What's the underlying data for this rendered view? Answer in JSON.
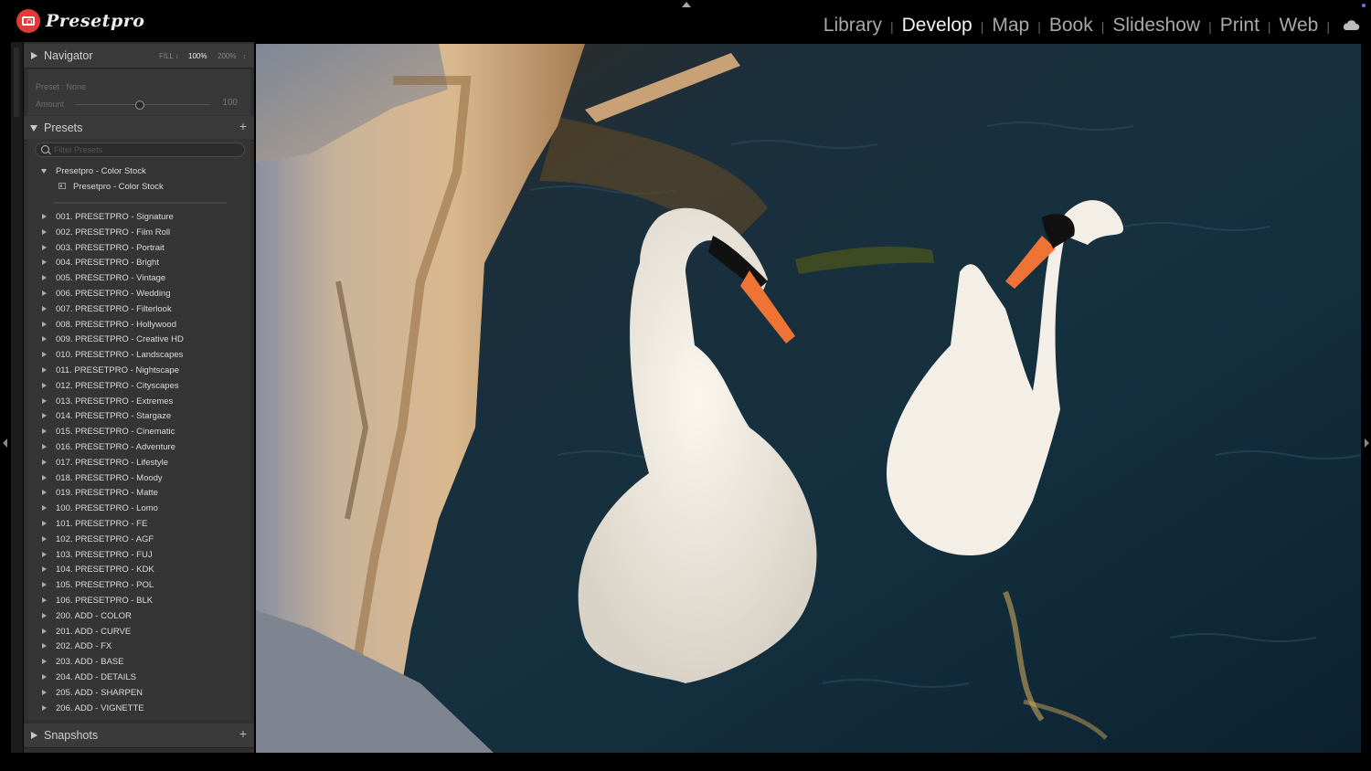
{
  "app": {
    "logo_text": "Presetpro"
  },
  "modules": [
    {
      "label": "Library",
      "active": false
    },
    {
      "label": "Develop",
      "active": true
    },
    {
      "label": "Map",
      "active": false
    },
    {
      "label": "Book",
      "active": false
    },
    {
      "label": "Slideshow",
      "active": false
    },
    {
      "label": "Print",
      "active": false
    },
    {
      "label": "Web",
      "active": false
    }
  ],
  "navigator": {
    "title": "Navigator",
    "zoom": [
      "FILL",
      "100%",
      "200%"
    ],
    "zoom_selected": "100%",
    "preset_label": "Preset : None",
    "amount_label": "Amount",
    "amount_value": "100"
  },
  "presets": {
    "title": "Presets",
    "filter_placeholder": "Filter Presets",
    "open_group": "Presetpro - Color Stock",
    "open_group_item": "Presetpro - Color Stock",
    "groups": [
      "001. PRESETPRO - Signature",
      "002. PRESETPRO - Film Roll",
      "003. PRESETPRO - Portrait",
      "004. PRESETPRO - Bright",
      "005. PRESETPRO - Vintage",
      "006. PRESETPRO - Wedding",
      "007. PRESETPRO - Filterlook",
      "008. PRESETPRO - Hollywood",
      "009. PRESETPRO - Creative HD",
      "010. PRESETPRO - Landscapes",
      "011. PRESETPRO - Nightscape",
      "012. PRESETPRO - Cityscapes",
      "013. PRESETPRO - Extremes",
      "014. PRESETPRO - Stargaze",
      "015. PRESETPRO - Cinematic",
      "016. PRESETPRO - Adventure",
      "017. PRESETPRO - Lifestyle",
      "018. PRESETPRO - Moody",
      "019. PRESETPRO - Matte",
      "100. PRESETPRO - Lomo",
      "101. PRESETPRO - FE",
      "102. PRESETPRO - AGF",
      "103. PRESETPRO - FUJ",
      "104. PRESETPRO - KDK",
      "105. PRESETPRO - POL",
      "106. PRESETPRO - BLK",
      "200. ADD - COLOR",
      "201. ADD - CURVE",
      "202. ADD - FX",
      "203. ADD - BASE",
      "204. ADD - DETAILS",
      "205. ADD - SHARPEN",
      "206. ADD - VIGNETTE"
    ]
  },
  "snapshots": {
    "title": "Snapshots"
  },
  "colors": {
    "accent_logo": "#e23a3a",
    "panel_bg": "#2f2f2f",
    "water": "#0f2433"
  }
}
